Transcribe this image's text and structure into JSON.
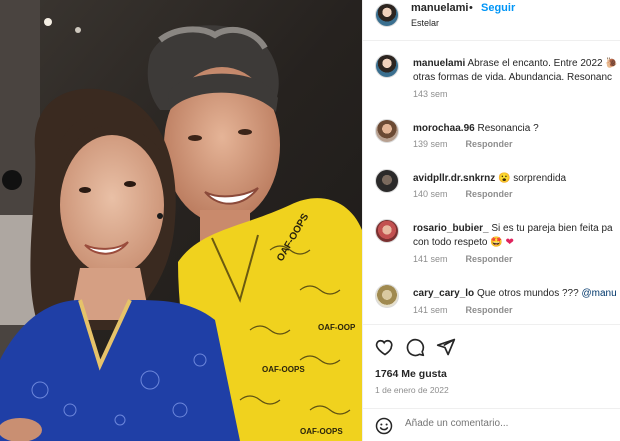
{
  "header": {
    "username": "manuelami",
    "separator": "•",
    "follow_label": "Seguir",
    "subtitle": "Estelar"
  },
  "comments": [
    {
      "user": "manuelami",
      "text": "Abrase el encanto. Entre 2022 🐌",
      "text2": "otras formas de vida. Abundancia. Resonanc",
      "time": "143 sem",
      "reply": ""
    },
    {
      "user": "morochaa.96",
      "text": "Resonancia ?",
      "time": "139 sem",
      "reply": "Responder"
    },
    {
      "user": "avidpllr.dr.snkrnz",
      "text": "😮 sorprendida",
      "time": "140 sem",
      "reply": "Responder"
    },
    {
      "user": "rosario_bubier_",
      "text": "Si es tu pareja bien feita pa",
      "text2": "con todo respeto 🤩",
      "heart": "❤",
      "time": "141 sem",
      "reply": "Responder"
    },
    {
      "user": "cary_cary_lo",
      "text": "Que otros mundos ???",
      "mention": "@manu",
      "time": "141 sem",
      "reply": "Responder"
    }
  ],
  "actions": {
    "likes": "1764 Me gusta",
    "date": "1 de enero de 2022",
    "comment_placeholder": "Añade un comentario..."
  },
  "icons": {
    "like": "heart-icon",
    "comment": "comment-bubble-icon",
    "share": "paper-plane-icon",
    "emoji": "smiley-icon"
  },
  "colors": {
    "follow": "#0095f6",
    "muted": "#8e8e8e",
    "shirt": "#f0d21e",
    "dress": "#1f3fa6"
  }
}
